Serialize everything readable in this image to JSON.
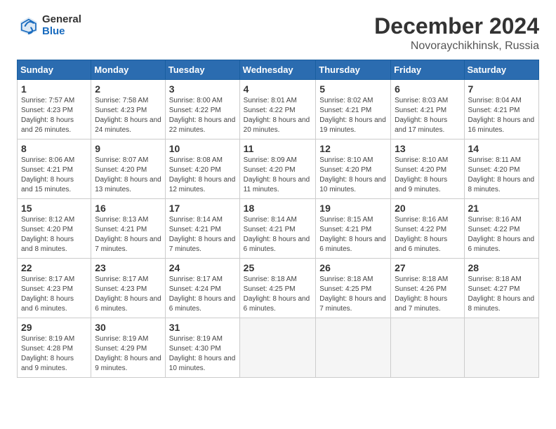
{
  "header": {
    "logo_general": "General",
    "logo_blue": "Blue",
    "month_title": "December 2024",
    "location": "Novoraychikhinsk, Russia"
  },
  "days_of_week": [
    "Sunday",
    "Monday",
    "Tuesday",
    "Wednesday",
    "Thursday",
    "Friday",
    "Saturday"
  ],
  "weeks": [
    [
      {
        "day": "1",
        "sunrise": "7:57 AM",
        "sunset": "4:23 PM",
        "daylight": "8 hours and 26 minutes."
      },
      {
        "day": "2",
        "sunrise": "7:58 AM",
        "sunset": "4:23 PM",
        "daylight": "8 hours and 24 minutes."
      },
      {
        "day": "3",
        "sunrise": "8:00 AM",
        "sunset": "4:22 PM",
        "daylight": "8 hours and 22 minutes."
      },
      {
        "day": "4",
        "sunrise": "8:01 AM",
        "sunset": "4:22 PM",
        "daylight": "8 hours and 20 minutes."
      },
      {
        "day": "5",
        "sunrise": "8:02 AM",
        "sunset": "4:21 PM",
        "daylight": "8 hours and 19 minutes."
      },
      {
        "day": "6",
        "sunrise": "8:03 AM",
        "sunset": "4:21 PM",
        "daylight": "8 hours and 17 minutes."
      },
      {
        "day": "7",
        "sunrise": "8:04 AM",
        "sunset": "4:21 PM",
        "daylight": "8 hours and 16 minutes."
      }
    ],
    [
      {
        "day": "8",
        "sunrise": "8:06 AM",
        "sunset": "4:21 PM",
        "daylight": "8 hours and 15 minutes."
      },
      {
        "day": "9",
        "sunrise": "8:07 AM",
        "sunset": "4:20 PM",
        "daylight": "8 hours and 13 minutes."
      },
      {
        "day": "10",
        "sunrise": "8:08 AM",
        "sunset": "4:20 PM",
        "daylight": "8 hours and 12 minutes."
      },
      {
        "day": "11",
        "sunrise": "8:09 AM",
        "sunset": "4:20 PM",
        "daylight": "8 hours and 11 minutes."
      },
      {
        "day": "12",
        "sunrise": "8:10 AM",
        "sunset": "4:20 PM",
        "daylight": "8 hours and 10 minutes."
      },
      {
        "day": "13",
        "sunrise": "8:10 AM",
        "sunset": "4:20 PM",
        "daylight": "8 hours and 9 minutes."
      },
      {
        "day": "14",
        "sunrise": "8:11 AM",
        "sunset": "4:20 PM",
        "daylight": "8 hours and 8 minutes."
      }
    ],
    [
      {
        "day": "15",
        "sunrise": "8:12 AM",
        "sunset": "4:20 PM",
        "daylight": "8 hours and 8 minutes."
      },
      {
        "day": "16",
        "sunrise": "8:13 AM",
        "sunset": "4:21 PM",
        "daylight": "8 hours and 7 minutes."
      },
      {
        "day": "17",
        "sunrise": "8:14 AM",
        "sunset": "4:21 PM",
        "daylight": "8 hours and 7 minutes."
      },
      {
        "day": "18",
        "sunrise": "8:14 AM",
        "sunset": "4:21 PM",
        "daylight": "8 hours and 6 minutes."
      },
      {
        "day": "19",
        "sunrise": "8:15 AM",
        "sunset": "4:21 PM",
        "daylight": "8 hours and 6 minutes."
      },
      {
        "day": "20",
        "sunrise": "8:16 AM",
        "sunset": "4:22 PM",
        "daylight": "8 hours and 6 minutes."
      },
      {
        "day": "21",
        "sunrise": "8:16 AM",
        "sunset": "4:22 PM",
        "daylight": "8 hours and 6 minutes."
      }
    ],
    [
      {
        "day": "22",
        "sunrise": "8:17 AM",
        "sunset": "4:23 PM",
        "daylight": "8 hours and 6 minutes."
      },
      {
        "day": "23",
        "sunrise": "8:17 AM",
        "sunset": "4:23 PM",
        "daylight": "8 hours and 6 minutes."
      },
      {
        "day": "24",
        "sunrise": "8:17 AM",
        "sunset": "4:24 PM",
        "daylight": "8 hours and 6 minutes."
      },
      {
        "day": "25",
        "sunrise": "8:18 AM",
        "sunset": "4:25 PM",
        "daylight": "8 hours and 6 minutes."
      },
      {
        "day": "26",
        "sunrise": "8:18 AM",
        "sunset": "4:25 PM",
        "daylight": "8 hours and 7 minutes."
      },
      {
        "day": "27",
        "sunrise": "8:18 AM",
        "sunset": "4:26 PM",
        "daylight": "8 hours and 7 minutes."
      },
      {
        "day": "28",
        "sunrise": "8:18 AM",
        "sunset": "4:27 PM",
        "daylight": "8 hours and 8 minutes."
      }
    ],
    [
      {
        "day": "29",
        "sunrise": "8:19 AM",
        "sunset": "4:28 PM",
        "daylight": "8 hours and 9 minutes."
      },
      {
        "day": "30",
        "sunrise": "8:19 AM",
        "sunset": "4:29 PM",
        "daylight": "8 hours and 9 minutes."
      },
      {
        "day": "31",
        "sunrise": "8:19 AM",
        "sunset": "4:30 PM",
        "daylight": "8 hours and 10 minutes."
      },
      null,
      null,
      null,
      null
    ]
  ]
}
